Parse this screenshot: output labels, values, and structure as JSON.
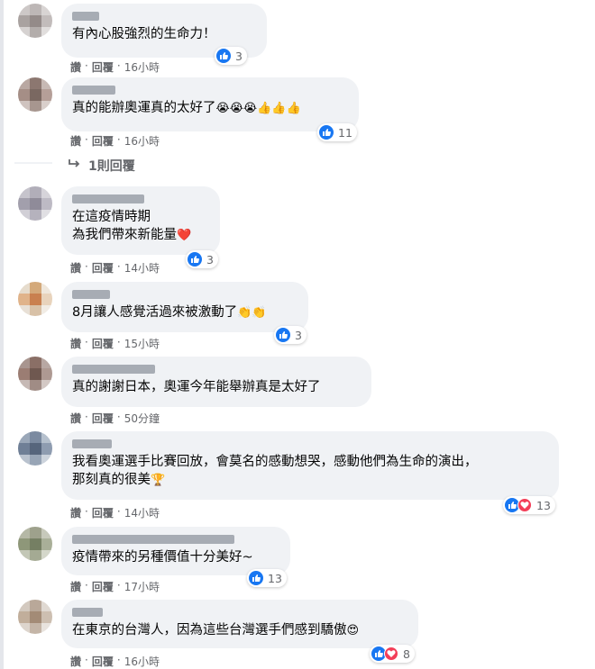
{
  "actions": {
    "like": "讚",
    "reply": "回覆",
    "sep": "·"
  },
  "replies_link": {
    "label": "1則回覆"
  },
  "comments": [
    {
      "text": "有內心股強烈的生命力！",
      "count": "3",
      "time": "16小時"
    },
    {
      "text": "真的能辦奧運真的太好了",
      "emoji": "😭😭😭👍👍👍",
      "count": "11",
      "time": "16小時"
    },
    {
      "text": "在這疫情時期\n為我們帶來新能量",
      "emoji": "❤️",
      "count": "3",
      "time": "14小時"
    },
    {
      "text": "8月讓人感覺活過來被激動了",
      "emoji": "👏👏",
      "count": "3",
      "time": "15小時"
    },
    {
      "text": "真的謝謝日本，奧運今年能舉辦真是太好了",
      "time": "50分鐘"
    },
    {
      "text": "我看奧運選手比賽回放，會莫名的感動想哭，感動他們為生命的演出，\n那刻真的很美",
      "emoji": "🏆",
      "count": "13",
      "time": "14小時"
    },
    {
      "text": "疫情帶來的另種價值十分美好~",
      "count": "13",
      "time": "17小時"
    },
    {
      "text": "在東京的台灣人，因為這些台灣選手們感到驕傲",
      "emoji": "😍",
      "count": "8",
      "time": "16小時"
    }
  ],
  "colors": {
    "like": "#1877f2",
    "love": "#f33e58",
    "bubble": "#f0f2f5",
    "meta": "#65676b"
  }
}
